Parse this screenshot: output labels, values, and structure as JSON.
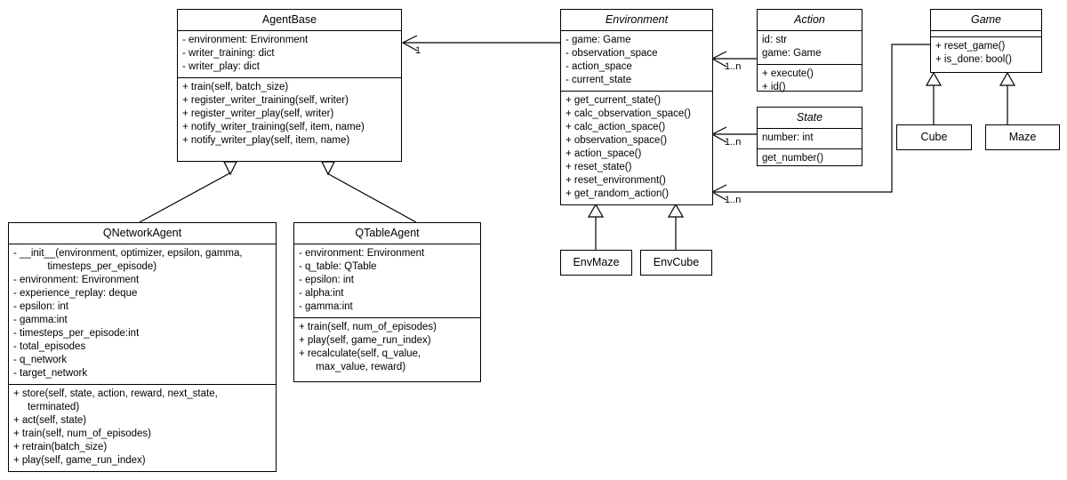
{
  "diagram": {
    "title": "Reinforcement Learning Agent UML Class Diagram",
    "type": "uml-class-diagram",
    "stroke_color": "#000000",
    "fill_color": "#ffffff",
    "background": "#ffffff"
  },
  "classes": {
    "agent_base": {
      "name": "AgentBase",
      "abstract": false,
      "attributes": [
        "- environment: Environment",
        "- writer_training: dict",
        "- writer_play: dict"
      ],
      "methods": [
        "+ train(self, batch_size)",
        "+ register_writer_training(self, writer)",
        "+ register_writer_play(self, writer)",
        "+ notify_writer_training(self, item, name)",
        "+ notify_writer_play(self, item, name)"
      ]
    },
    "environment": {
      "name": "Environment",
      "abstract": true,
      "attributes": [
        "- game: Game",
        "- observation_space",
        "- action_space",
        "- current_state"
      ],
      "methods": [
        "+ get_current_state()",
        "+ calc_observation_space()",
        "+ calc_action_space()",
        "+ observation_space()",
        "+ action_space()",
        "+ reset_state()",
        "+ reset_environment()",
        "+ get_random_action()"
      ]
    },
    "action": {
      "name": "Action",
      "abstract": true,
      "attributes": [
        "id: str",
        "game: Game"
      ],
      "methods": [
        "+ execute()",
        "+ id()"
      ]
    },
    "state": {
      "name": "State",
      "abstract": true,
      "attributes": [
        "number: int"
      ],
      "methods": [
        "get_number()"
      ]
    },
    "game": {
      "name": "Game",
      "abstract": true,
      "attributes": [],
      "methods": [
        "+ reset_game()",
        "+ is_done: bool()"
      ]
    },
    "cube": {
      "name": "Cube",
      "abstract": false,
      "attributes": [],
      "methods": []
    },
    "maze": {
      "name": "Maze",
      "abstract": false,
      "attributes": [],
      "methods": []
    },
    "env_maze": {
      "name": "EnvMaze",
      "abstract": false,
      "attributes": [],
      "methods": []
    },
    "env_cube": {
      "name": "EnvCube",
      "abstract": false,
      "attributes": [],
      "methods": []
    },
    "qnetwork_agent": {
      "name": "QNetworkAgent",
      "abstract": false,
      "attributes": [
        "- __init__(environment, optimizer, epsilon, gamma,\n            timesteps_per_episode)",
        "- environment: Environment",
        "- experience_replay: deque",
        "- epsilon: int",
        "- gamma:int",
        "- timesteps_per_episode:int",
        "- total_episodes",
        "- q_network",
        "- target_network"
      ],
      "methods": [
        "+ store(self, state, action, reward, next_state,\n     terminated)",
        "+ act(self, state)",
        "+ train(self, num_of_episodes)",
        "+ retrain(batch_size)",
        "+ play(self, game_run_index)"
      ]
    },
    "qtable_agent": {
      "name": "QTableAgent",
      "abstract": false,
      "attributes": [
        "- environment: Environment",
        "- q_table: QTable",
        "- epsilon: int",
        "- alpha:int",
        "- gamma:int"
      ],
      "methods": [
        "+ train(self, num_of_episodes)",
        "+ play(self, game_run_index)",
        "+ recalculate(self, q_value,\n      max_value, reward)"
      ]
    }
  },
  "relationships": {
    "multiplicities": {
      "agentbase_environment": "1",
      "environment_action": "1..n",
      "environment_state": "1..n",
      "environment_game": "1..n"
    }
  }
}
